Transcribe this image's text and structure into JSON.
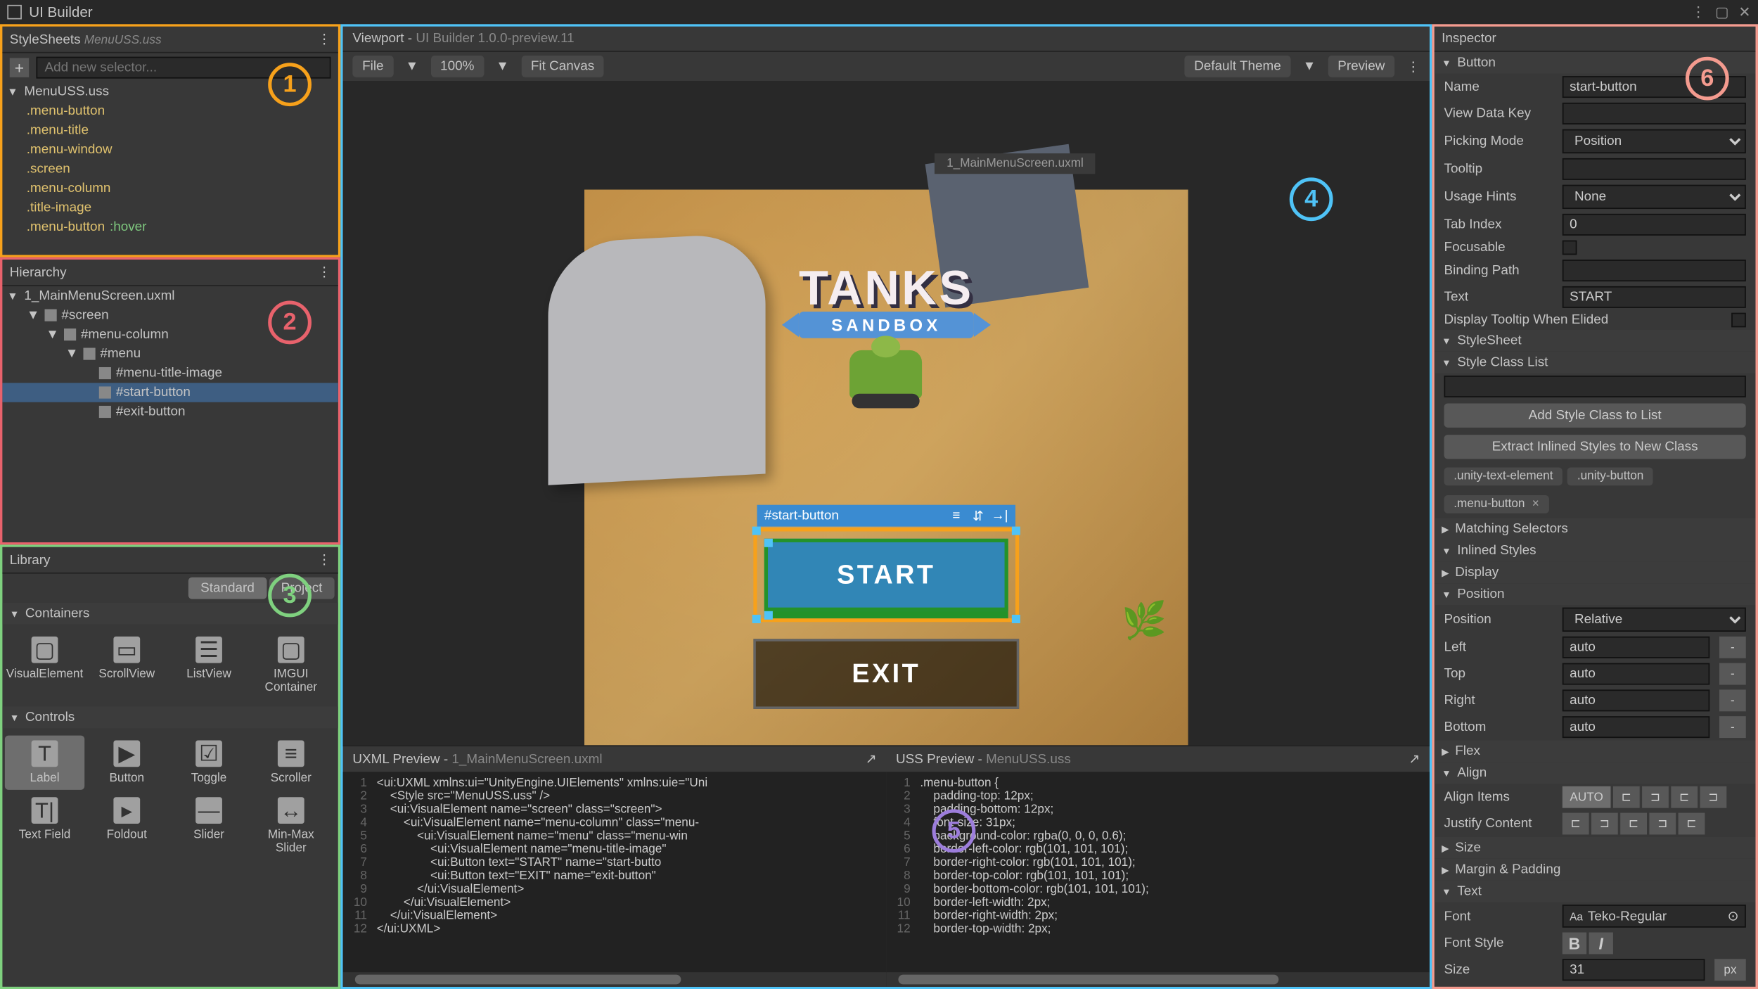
{
  "window_title": "UI Builder",
  "stylesheets": {
    "title": "StyleSheets",
    "file": "MenuUSS.uss",
    "add_placeholder": "Add new selector...",
    "selectors": [
      {
        "name": ".menu-button"
      },
      {
        "name": ".menu-title"
      },
      {
        "name": ".menu-window"
      },
      {
        "name": ".screen"
      },
      {
        "name": ".menu-column"
      },
      {
        "name": ".title-image"
      },
      {
        "name": ".menu-button",
        "pseudo": ":hover"
      }
    ]
  },
  "hierarchy": {
    "title": "Hierarchy",
    "root": "1_MainMenuScreen.uxml",
    "items": [
      {
        "id": "#screen",
        "indent": 1
      },
      {
        "id": "#menu-column",
        "indent": 2
      },
      {
        "id": "#menu",
        "indent": 3
      },
      {
        "id": "#menu-title-image",
        "indent": 4
      },
      {
        "id": "#start-button",
        "indent": 4,
        "selected": true
      },
      {
        "id": "#exit-button",
        "indent": 4
      }
    ]
  },
  "library": {
    "title": "Library",
    "tabs": {
      "standard": "Standard",
      "project": "Project"
    },
    "containers_label": "Containers",
    "controls_label": "Controls",
    "containers": [
      {
        "label": "VisualElement",
        "glyph": "▢"
      },
      {
        "label": "ScrollView",
        "glyph": "▭"
      },
      {
        "label": "ListView",
        "glyph": "☰"
      },
      {
        "label": "IMGUI Container",
        "glyph": "▢"
      }
    ],
    "controls": [
      {
        "label": "Label",
        "glyph": "T"
      },
      {
        "label": "Button",
        "glyph": "▶"
      },
      {
        "label": "Toggle",
        "glyph": "☑"
      },
      {
        "label": "Scroller",
        "glyph": "≡"
      },
      {
        "label": "Text Field",
        "glyph": "T|"
      },
      {
        "label": "Foldout",
        "glyph": "▸"
      },
      {
        "label": "Slider",
        "glyph": "—"
      },
      {
        "label": "Min-Max Slider",
        "glyph": "↔"
      }
    ]
  },
  "viewport": {
    "title": "Viewport",
    "version": "UI Builder 1.0.0-preview.11",
    "file_menu": "File",
    "zoom": "100%",
    "fit": "Fit Canvas",
    "theme": "Default Theme",
    "preview": "Preview",
    "canvas_file": "1_MainMenuScreen.uxml",
    "selection_label": "#start-button",
    "game_title": "TANKS",
    "game_subtitle": "SANDBOX",
    "start_label": "START",
    "exit_label": "EXIT"
  },
  "uxml_preview": {
    "title": "UXML Preview",
    "file": "1_MainMenuScreen.uxml",
    "lines": [
      "<ui:UXML xmlns:ui=\"UnityEngine.UIElements\" xmlns:uie=\"Uni",
      "    <Style src=\"MenuUSS.uss\" />",
      "    <ui:VisualElement name=\"screen\" class=\"screen\">",
      "        <ui:VisualElement name=\"menu-column\" class=\"menu-",
      "            <ui:VisualElement name=\"menu\" class=\"menu-win",
      "                <ui:VisualElement name=\"menu-title-image\"",
      "                <ui:Button text=\"START\" name=\"start-butto",
      "                <ui:Button text=\"EXIT\" name=\"exit-button\"",
      "            </ui:VisualElement>",
      "        </ui:VisualElement>",
      "    </ui:VisualElement>",
      "</ui:UXML>"
    ]
  },
  "uss_preview": {
    "title": "USS Preview",
    "file": "MenuUSS.uss",
    "lines": [
      ".menu-button {",
      "    padding-top: 12px;",
      "    padding-bottom: 12px;",
      "    font-size: 31px;",
      "    background-color: rgba(0, 0, 0, 0.6);",
      "    border-left-color: rgb(101, 101, 101);",
      "    border-right-color: rgb(101, 101, 101);",
      "    border-top-color: rgb(101, 101, 101);",
      "    border-bottom-color: rgb(101, 101, 101);",
      "    border-left-width: 2px;",
      "    border-right-width: 2px;",
      "    border-top-width: 2px;"
    ]
  },
  "inspector": {
    "title": "Inspector",
    "section_button": "Button",
    "name_label": "Name",
    "name_value": "start-button",
    "vdk_label": "View Data Key",
    "picking_label": "Picking Mode",
    "picking_value": "Position",
    "tooltip_label": "Tooltip",
    "usage_label": "Usage Hints",
    "usage_value": "None",
    "tabindex_label": "Tab Index",
    "tabindex_value": "0",
    "focusable_label": "Focusable",
    "binding_label": "Binding Path",
    "text_label": "Text",
    "text_value": "START",
    "display_tooltip_label": "Display Tooltip When Elided",
    "stylesheet_label": "StyleSheet",
    "styleclass_label": "Style Class List",
    "add_class_btn": "Add Style Class to List",
    "extract_btn": "Extract Inlined Styles to New Class",
    "tags": [
      ".unity-text-element",
      ".unity-button",
      ".menu-button"
    ],
    "matching_label": "Matching Selectors",
    "inlined_label": "Inlined Styles",
    "display_label": "Display",
    "position_section": "Position",
    "position_label": "Position",
    "position_value": "Relative",
    "left_label": "Left",
    "left_value": "auto",
    "top_label": "Top",
    "top_value": "auto",
    "right_label": "Right",
    "right_value": "auto",
    "bottom_label": "Bottom",
    "bottom_value": "auto",
    "flex_label": "Flex",
    "align_label": "Align",
    "align_items_label": "Align Items",
    "justify_label": "Justify Content",
    "auto_btn": "AUTO",
    "size_label": "Size",
    "margin_label": "Margin & Padding",
    "text_section": "Text",
    "font_label": "Font",
    "font_value": "Teko-Regular",
    "fontstyle_label": "Font Style",
    "size_field_label": "Size",
    "size_value": "31",
    "size_unit": "px"
  },
  "badges": {
    "b1": "1",
    "b2": "2",
    "b3": "3",
    "b4": "4",
    "b5": "5",
    "b6": "6"
  }
}
